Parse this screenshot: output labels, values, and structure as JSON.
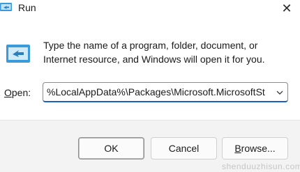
{
  "window": {
    "title": "Run",
    "close_glyph": "✕"
  },
  "dialog": {
    "description": "Type the name of a program, folder, document, or Internet resource, and Windows will open it for you.",
    "open_label_underlined": "O",
    "open_label_rest": "pen:",
    "open_value": "%LocalAppData%\\Packages\\Microsoft.MicrosoftSt"
  },
  "buttons": {
    "ok": "OK",
    "cancel": "Cancel",
    "browse_underlined": "B",
    "browse_rest": "rowse..."
  },
  "icons": {
    "title": "run-app-icon",
    "main": "run-app-icon",
    "close": "close-icon",
    "dropdown": "chevron-down-icon"
  },
  "watermark": "shenduuzhisun.com",
  "colors": {
    "accent": "#1b5fc5",
    "icon_blue": "#3b9ad9",
    "footer_bg": "#f3f3f3"
  }
}
